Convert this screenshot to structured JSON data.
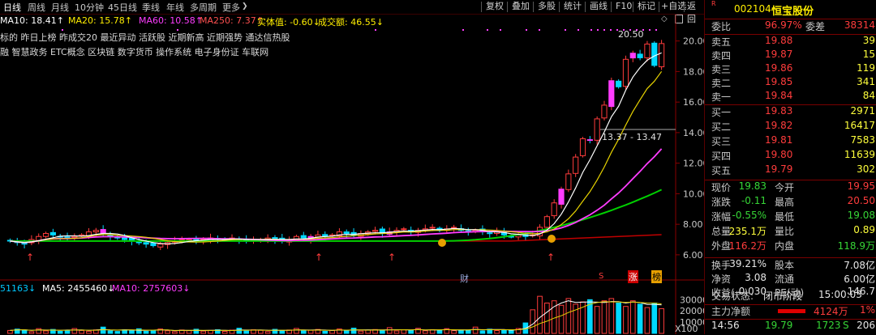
{
  "toolbar": {
    "timeframes": [
      "日线",
      "周线",
      "月线",
      "10分钟",
      "45日线",
      "季线",
      "年线",
      "多周期",
      "更多"
    ],
    "buttons": [
      "复权",
      "叠加",
      "多股",
      "统计",
      "画线",
      "F10",
      "标记",
      "+自选",
      "返回"
    ]
  },
  "ma_line": {
    "ma10": "MA10: 18.41↑",
    "ma20": "MA20: 15.78↑",
    "ma60": "MA60: 10.58↑",
    "ma250": "MA250: 7.37↑",
    "real": "实体值: -0.60↓",
    "turnover": "成交额: 46.55↓"
  },
  "tags_line1": "标的 昨日上榜 昨成交20 最近异动 活跃股 近期新高 近期强势 通达信热股",
  "tags_line2": "融 智慧政务 ETC概念 区块链 数字货币 操作系统 电子身份证 车联网",
  "annotations": {
    "high": "20.50",
    "range": "13.37 - 13.47",
    "cai": "财",
    "s": "S",
    "zhang": "涨",
    "bang": "榜"
  },
  "chart_data": [
    {
      "type": "candlestick",
      "ylim": [
        5.2,
        21.2
      ],
      "yticks": [
        "20.00",
        "18.00",
        "16.00",
        "14.00",
        "12.00",
        "10.00",
        "8.00",
        "6.00"
      ],
      "ytick_values": [
        20,
        18,
        16,
        14,
        12,
        10,
        8,
        6
      ],
      "close_prices": [
        6.9,
        6.8,
        6.7,
        7.0,
        7.2,
        7.4,
        7.3,
        7.2,
        7.1,
        7.2,
        7.3,
        7.5,
        7.6,
        7.4,
        7.2,
        7.1,
        7.0,
        6.9,
        6.8,
        6.7,
        6.6,
        6.7,
        6.8,
        6.9,
        7.0,
        7.0,
        6.9,
        7.0,
        7.1,
        7.0,
        7.0,
        7.1,
        7.0,
        6.9,
        7.0,
        7.0,
        7.1,
        7.0,
        6.9,
        7.0,
        7.2,
        7.1,
        7.2,
        7.3,
        7.2,
        7.3,
        7.5,
        7.4,
        7.3,
        7.4,
        7.5,
        7.6,
        7.4,
        7.5,
        7.6,
        7.7,
        7.5,
        7.6,
        7.7,
        7.8,
        7.6,
        7.7,
        7.8,
        7.6,
        7.5,
        7.6,
        7.5,
        7.4,
        7.5,
        7.3,
        7.2,
        7.3,
        7.2,
        7.3,
        7.8,
        8.5,
        9.4,
        10.3,
        11.3,
        12.4,
        13.6,
        13.5,
        14.9,
        15.8,
        17.4,
        17.0,
        18.8,
        19.2,
        18.9,
        19.8,
        18.4,
        19.83
      ],
      "ma_series": [
        {
          "name": "MA10",
          "color": "#ffffff"
        },
        {
          "name": "MA20",
          "color": "#e6d200"
        },
        {
          "name": "MA60",
          "color": "#ff3cff"
        },
        {
          "name": "MA250",
          "color": "#00d000"
        }
      ],
      "ma_extra": {
        "name": "MA250(红)",
        "color": "#c00000"
      }
    },
    {
      "type": "bar",
      "title": "VOL",
      "legend": {
        "vol": "51163↓",
        "ma5": "MA5: 2455460↓",
        "ma10": "MA10: 2757603↓"
      },
      "ylim": [
        0,
        36000
      ],
      "yticks": [
        "30000",
        "20000",
        "10000",
        "X100"
      ],
      "ytick_values": [
        30000,
        20000,
        10000
      ],
      "volumes": [
        2600,
        3800,
        3000,
        1500,
        4200,
        2200,
        3500,
        1800,
        2900,
        4300,
        2600,
        1900,
        3100,
        5600,
        2200,
        1700,
        3200,
        2500,
        4100,
        1900,
        2800,
        3900,
        2300,
        1500,
        3000,
        2400,
        3700,
        2000,
        2600,
        3300,
        1800,
        2900,
        4600,
        2100,
        3200,
        2700,
        1600,
        3600,
        2400,
        3000,
        4400,
        2200,
        2800,
        3500,
        1900,
        2600,
        3900,
        2300,
        4700,
        2000,
        2900,
        3400,
        2500,
        5100,
        2200,
        3100,
        2700,
        4500,
        2300,
        3300,
        2600,
        4200,
        2400,
        3000,
        2800,
        5600,
        2200,
        3700,
        2500,
        3100,
        2900,
        4300,
        9300,
        21000,
        33000,
        27000,
        29000,
        25000,
        31000,
        26000,
        28000,
        30000,
        24000,
        29000,
        31000,
        27000,
        24000,
        29000,
        26000,
        23000,
        27000,
        22000
      ],
      "ma5_color": "#ffffff",
      "ma10_color": "#e6d200"
    }
  ],
  "quote": {
    "code": "002104",
    "name": "恒宝股份",
    "weibi_label": "委比",
    "weibi_value": "96.97%",
    "weicha_label": "委差",
    "weicha_value": "38314",
    "asks": [
      {
        "label": "卖五",
        "price": "19.88",
        "vol": "39"
      },
      {
        "label": "卖四",
        "price": "19.87",
        "vol": "15"
      },
      {
        "label": "卖三",
        "price": "19.86",
        "vol": "119"
      },
      {
        "label": "卖二",
        "price": "19.85",
        "vol": "341"
      },
      {
        "label": "卖一",
        "price": "19.84",
        "vol": "84"
      }
    ],
    "bids": [
      {
        "label": "买一",
        "price": "19.83",
        "vol": "2971"
      },
      {
        "label": "买二",
        "price": "19.82",
        "vol": "16417"
      },
      {
        "label": "买三",
        "price": "19.81",
        "vol": "7583"
      },
      {
        "label": "买四",
        "price": "19.80",
        "vol": "11639"
      },
      {
        "label": "买五",
        "price": "19.79",
        "vol": "302"
      }
    ],
    "stats": [
      {
        "l1": "现价",
        "v1": "19.83",
        "c1": "grn",
        "l2": "今开",
        "v2": "19.95",
        "c2": "red"
      },
      {
        "l1": "涨跌",
        "v1": "-0.11",
        "c1": "grn",
        "l2": "最高",
        "v2": "20.50",
        "c2": "red"
      },
      {
        "l1": "涨幅",
        "v1": "-0.55%",
        "c1": "grn",
        "l2": "最低",
        "v2": "19.08",
        "c2": "grn"
      },
      {
        "l1": "总量",
        "v1": "235.1万",
        "c1": "yel",
        "l2": "量比",
        "v2": "0.89",
        "c2": "yel"
      },
      {
        "l1": "外盘",
        "v1": "116.2万",
        "c1": "red",
        "l2": "内盘",
        "v2": "118.9万",
        "c2": "grn"
      }
    ],
    "stats2": [
      {
        "l1": "换手",
        "v1": "39.21%",
        "l2": "股本",
        "v2": "7.08亿"
      },
      {
        "l1": "净资",
        "v1": "3.08",
        "l2": "流通",
        "v2": "6.00亿"
      },
      {
        "l1": "收益(一)",
        "v1": "0.030",
        "l2": "PE(动)",
        "v2": "146.7"
      }
    ],
    "trade_status_label": "交易状态:",
    "trade_status": "闭市阶段",
    "trade_time": "15:00:03",
    "main_net_label": "主力净额",
    "main_net_value": "4124万",
    "main_net_pct": "1%",
    "tick_time": "14:56",
    "tick_price": "19.79",
    "tick_vol": "1723",
    "tick_flag": "S",
    "tick_num": "206"
  }
}
